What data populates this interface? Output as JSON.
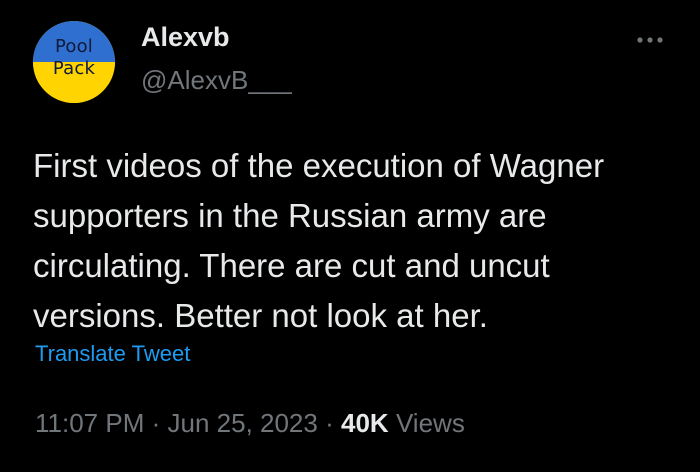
{
  "author": {
    "display_name": "Alexvb",
    "handle": "@AlexvB___",
    "avatar_text_line1": "Pool",
    "avatar_text_line2": "Pack",
    "avatar_colors": {
      "top": "#2f6fcf",
      "bottom": "#ffd400"
    }
  },
  "more_icon": "more-horizontal-icon",
  "tweet": {
    "text": "First videos of the execution of Wagner\nsupporters in the Russian army are\ncirculating. There are cut and uncut\nversions. Better not look at her.",
    "translate_label": "Translate Tweet"
  },
  "meta": {
    "time": "11:07 PM",
    "separator": "·",
    "date": "Jun 25, 2023",
    "views_count": "40K",
    "views_label": "Views"
  },
  "colors": {
    "background": "#000000",
    "text_primary": "#e7e9ea",
    "text_secondary": "#71767b",
    "link": "#1d9bf0"
  }
}
